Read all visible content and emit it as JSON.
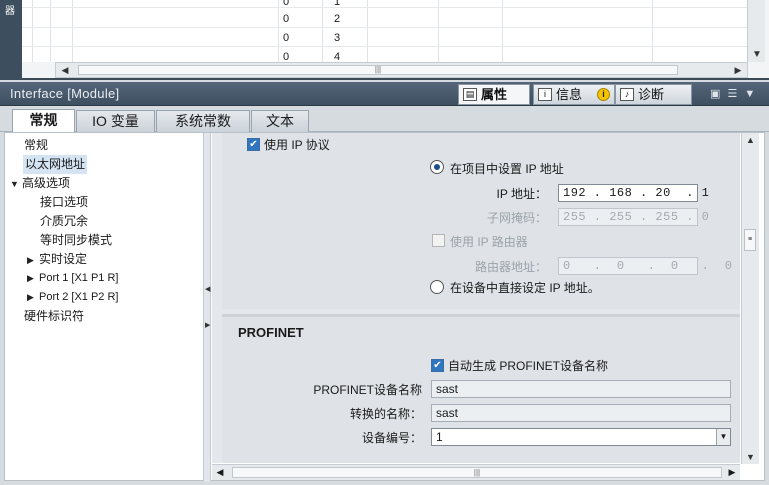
{
  "top_table": {
    "strip_label": "器",
    "rows": [
      {
        "a": "0",
        "b": "1"
      },
      {
        "a": "0",
        "b": "2"
      },
      {
        "a": "0",
        "b": "3"
      },
      {
        "a": "0",
        "b": "4"
      }
    ]
  },
  "inspector": {
    "title": "Interface [Module]",
    "tabs": [
      {
        "label": "属性"
      },
      {
        "label": "信息"
      },
      {
        "label": "诊断"
      }
    ]
  },
  "tabs": [
    {
      "label": "常规"
    },
    {
      "label": "IO 变量"
    },
    {
      "label": "系统常数"
    },
    {
      "label": "文本"
    }
  ],
  "nav": [
    {
      "label": "常规"
    },
    {
      "label": "以太网地址"
    },
    {
      "label": "高级选项"
    },
    {
      "label": "接口选项"
    },
    {
      "label": "介质冗余"
    },
    {
      "label": "等时同步模式"
    },
    {
      "label": "实时设定"
    },
    {
      "label": "Port 1 [X1 P1 R]"
    },
    {
      "label": "Port 2 [X1 P2 R]"
    },
    {
      "label": "硬件标识符"
    }
  ],
  "ip": {
    "use_ip_label": "使用 IP 协议",
    "set_in_project_label": "在项目中设置 IP 地址",
    "ip_address_label": "IP 地址：",
    "ip_address_value": "192 . 168 . 20  . 1",
    "subnet_label": "子网掩码：",
    "subnet_value": "255 . 255 . 255 . 0",
    "use_router_label": "使用 IP 路由器",
    "router_address_label": "路由器地址：",
    "router_address_value": "0   .  0   .  0   .  0",
    "set_on_device_label": "在设备中直接设定 IP 地址。"
  },
  "profinet": {
    "title": "PROFINET",
    "auto_name_label": "自动生成 PROFINET设备名称",
    "device_name_label": "PROFINET设备名称",
    "device_name_value": "sast",
    "converted_name_label": "转换的名称：",
    "converted_name_value": "sast",
    "device_number_label": "设备编号：",
    "device_number_value": "1"
  }
}
